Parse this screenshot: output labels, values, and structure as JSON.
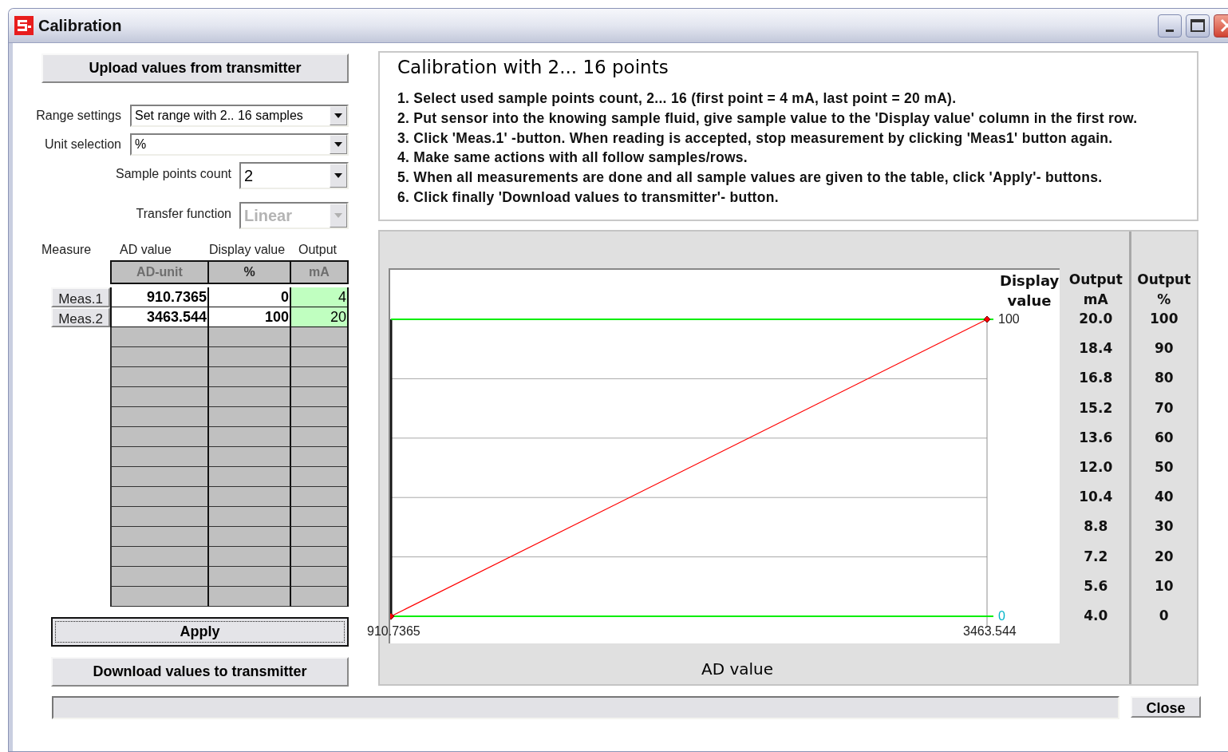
{
  "window": {
    "title": "Calibration"
  },
  "upload_button": "Upload values from transmitter",
  "selections": [
    {
      "label": "Range settings",
      "value": "Set range with 2.. 16 samples",
      "disabled": false
    },
    {
      "label": "Unit selection",
      "value": "%",
      "disabled": false
    }
  ],
  "parameters": [
    {
      "label": "Sample points count",
      "value": "2",
      "disabled": false
    },
    {
      "label": "Transfer function",
      "value": "Linear",
      "disabled": true
    }
  ],
  "table": {
    "measure_heading": "Measure",
    "columns": [
      {
        "heading": "AD value",
        "unit": "AD-unit",
        "unit_enabled": false,
        "highlighted": false
      },
      {
        "heading": "Display value",
        "unit": "%",
        "unit_enabled": true,
        "highlighted": false
      },
      {
        "heading": "Output",
        "unit": "mA",
        "unit_enabled": false,
        "highlighted": true
      }
    ],
    "rows": [
      {
        "button": "Meas.1",
        "cells": [
          "910.7365",
          "0",
          "4"
        ]
      },
      {
        "button": "Meas.2",
        "cells": [
          "3463.544",
          "100",
          "20"
        ]
      }
    ]
  },
  "apply_button": {
    "label": "Apply",
    "focused": true
  },
  "download_button": "Download values to transmitter",
  "instructions": {
    "title": "Calibration with 2... 16 points",
    "steps": [
      "1. Select used sample points count, 2... 16 (first point = 4 mA, last point = 20 mA).",
      "2. Put sensor into the knowing sample fluid, give sample value to the 'Display value' column in the first row.",
      "3. Click 'Meas.1' -button. When reading is accepted, stop measurement by clicking 'Meas1' button again.",
      "4. Make same actions with all follow samples/rows.",
      "5. When all measurements are done and all sample values are given to the table, click 'Apply'- buttons.",
      "6. Click finally 'Download values to transmitter'- button."
    ]
  },
  "chart": {
    "chart_data": {
      "type": "line",
      "xlabel": "AD value",
      "ylabel": "Display value",
      "x": [
        910.7365,
        3463.544
      ],
      "series": [
        {
          "color": "#ff0000",
          "marker": "diamond",
          "values": [
            0,
            100
          ]
        }
      ],
      "xlim": [
        910.7365,
        3463.544
      ],
      "ylim": [
        0,
        100
      ],
      "xticks": [
        {
          "value": 910.7365,
          "label": "910.7365"
        },
        {
          "value": 3463.544,
          "label": "3463.544"
        }
      ],
      "yticks": [
        {
          "value": 0,
          "label": "0"
        },
        {
          "value": 100,
          "label": "100"
        }
      ]
    }
  },
  "output_scales": [
    {
      "title": "Output",
      "unit": "mA",
      "values": [
        "20.0",
        "18.4",
        "16.8",
        "15.2",
        "13.6",
        "12.0",
        "10.4",
        "8.8",
        "7.2",
        "5.6",
        "4.0"
      ]
    },
    {
      "title": "Output",
      "unit": "%",
      "values": [
        "100",
        "90",
        "80",
        "70",
        "60",
        "50",
        "40",
        "30",
        "20",
        "10",
        "0"
      ]
    }
  ],
  "close_button": "Close"
}
